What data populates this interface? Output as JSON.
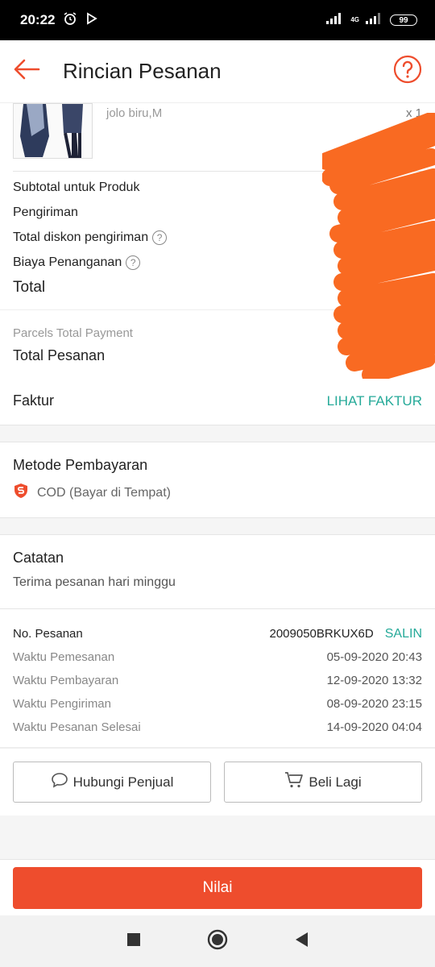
{
  "status_bar": {
    "time": "20:22",
    "network": "4G",
    "battery": "99"
  },
  "header": {
    "title": "Rincian Pesanan"
  },
  "product": {
    "variant": "jolo biru,M",
    "quantity": "x 1"
  },
  "summary": {
    "subtotal_label": "Subtotal untuk Produk",
    "shipping_label": "Pengiriman",
    "shipping_discount_label": "Total diskon pengiriman",
    "handling_fee_label": "Biaya Penanganan",
    "total_label": "Total"
  },
  "parcels": {
    "label": "Parcels Total Payment",
    "total_order_label": "Total Pesanan"
  },
  "invoice": {
    "label": "Faktur",
    "link": "LIHAT FAKTUR"
  },
  "payment": {
    "title": "Metode Pembayaran",
    "method": "COD (Bayar di Tempat)"
  },
  "notes": {
    "title": "Catatan",
    "text": "Terima pesanan hari minggu"
  },
  "order_info": {
    "order_no_label": "No. Pesanan",
    "order_no": "2009050BRKUX6D",
    "copy_label": "SALIN",
    "rows": [
      {
        "label": "Waktu Pemesanan",
        "value": "05-09-2020 20:43"
      },
      {
        "label": "Waktu Pembayaran",
        "value": "12-09-2020 13:32"
      },
      {
        "label": "Waktu Pengiriman",
        "value": "08-09-2020 23:15"
      },
      {
        "label": "Waktu Pesanan Selesai",
        "value": "14-09-2020 04:04"
      }
    ]
  },
  "actions": {
    "contact_seller": "Hubungi Penjual",
    "buy_again": "Beli Lagi",
    "rate": "Nilai"
  },
  "colors": {
    "primary": "#ee4d2d",
    "teal": "#26aa99",
    "scribble": "#f96a22"
  }
}
